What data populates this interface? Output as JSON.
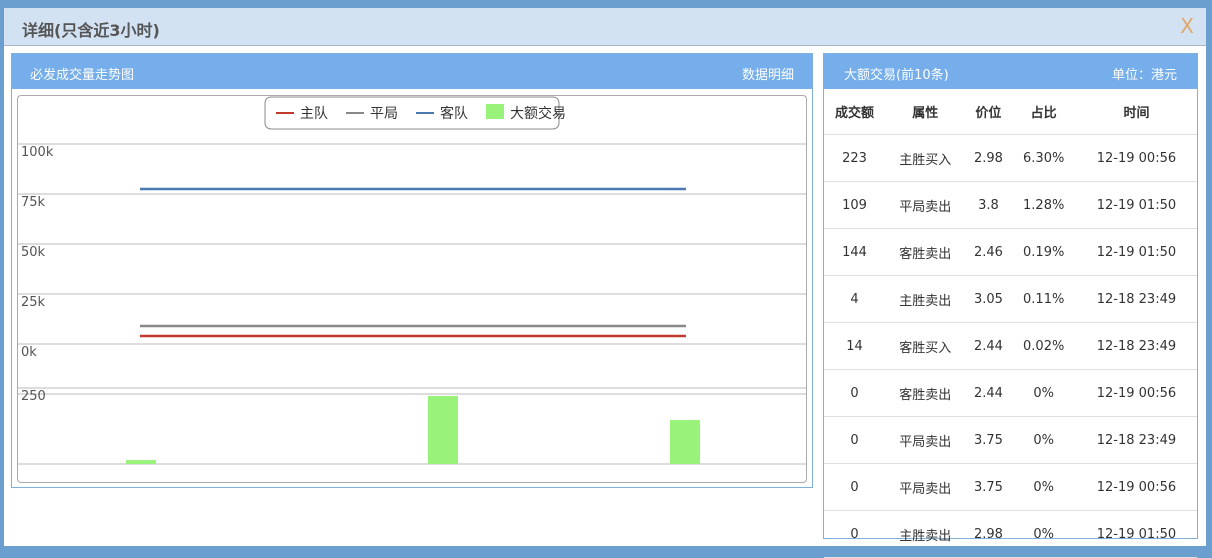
{
  "window": {
    "title": "详细(只含近3小时)",
    "close": "X"
  },
  "left": {
    "title": "必发成交量走势图",
    "link": "数据明细"
  },
  "right": {
    "title": "大额交易(前10条)",
    "unit": "单位：港元",
    "columns": [
      "成交额",
      "属性",
      "价位",
      "占比",
      "时间"
    ],
    "rows": [
      [
        "223",
        "主胜买入",
        "2.98",
        "6.30%",
        "12-19 00:56"
      ],
      [
        "109",
        "平局卖出",
        "3.8",
        "1.28%",
        "12-19 01:50"
      ],
      [
        "144",
        "客胜卖出",
        "2.46",
        "0.19%",
        "12-19 01:50"
      ],
      [
        "4",
        "主胜卖出",
        "3.05",
        "0.11%",
        "12-18 23:49"
      ],
      [
        "14",
        "客胜买入",
        "2.44",
        "0.02%",
        "12-18 23:49"
      ],
      [
        "0",
        "客胜卖出",
        "2.44",
        "0%",
        "12-19 00:56"
      ],
      [
        "0",
        "平局卖出",
        "3.75",
        "0%",
        "12-18 23:49"
      ],
      [
        "0",
        "平局卖出",
        "3.75",
        "0%",
        "12-19 00:56"
      ],
      [
        "0",
        "主胜卖出",
        "2.98",
        "0%",
        "12-19 01:50"
      ]
    ]
  },
  "chart_data": {
    "type": "line",
    "legend": [
      "主队",
      "平局",
      "客队",
      "大额交易"
    ],
    "colors": {
      "主队": "#c0392b",
      "平局": "#888888",
      "客队": "#4a78b0",
      "大额交易": "#99f37a"
    },
    "line_yticks": [
      "100k",
      "75k",
      "50k",
      "25k",
      "0k"
    ],
    "line_ylim": [
      0,
      100000
    ],
    "series": [
      {
        "name": "主队",
        "values": [
          4000,
          4000,
          4000
        ]
      },
      {
        "name": "平局",
        "values": [
          9000,
          9000,
          9000
        ]
      },
      {
        "name": "客队",
        "values": [
          77500,
          77500,
          77500
        ]
      }
    ],
    "bar_yticks": [
      "250"
    ],
    "bar_ylim": [
      0,
      250
    ],
    "bars": [
      14,
      243,
      157
    ]
  }
}
